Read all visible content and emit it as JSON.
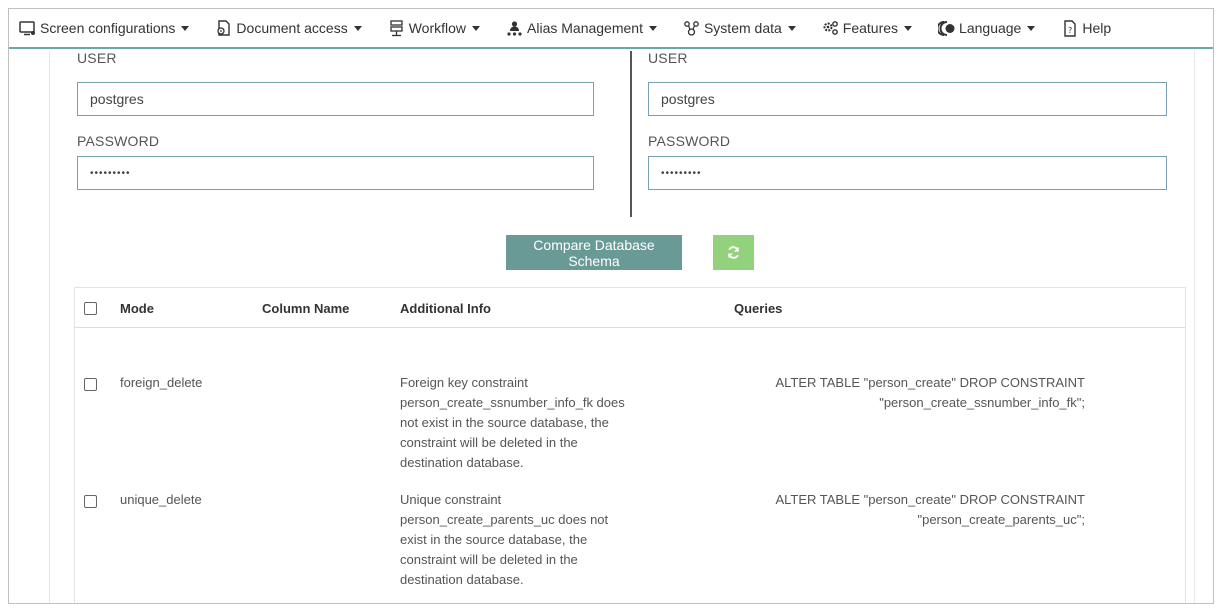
{
  "menu": [
    {
      "label": "Screen configurations",
      "icon": "monitor-icon",
      "has_caret": true
    },
    {
      "label": "Document access",
      "icon": "document-access-icon",
      "has_caret": true
    },
    {
      "label": "Workflow",
      "icon": "workflow-icon",
      "has_caret": true
    },
    {
      "label": "Alias Management",
      "icon": "alias-people-icon",
      "has_caret": true
    },
    {
      "label": "System data",
      "icon": "system-data-icon",
      "has_caret": true
    },
    {
      "label": "Features",
      "icon": "gears-icon",
      "has_caret": true
    },
    {
      "label": "Language",
      "icon": "language-icon",
      "has_caret": true
    },
    {
      "label": "Help",
      "icon": "help-document-icon",
      "has_caret": false
    }
  ],
  "source": {
    "user_label": "USER",
    "user_value": "postgres",
    "password_label": "PASSWORD",
    "password_value": "•••••••••"
  },
  "destination": {
    "user_label": "USER",
    "user_value": "postgres",
    "password_label": "PASSWORD",
    "password_value": "•••••••••"
  },
  "actions": {
    "compare_label": "Compare Database Schema",
    "refresh_icon": "refresh-icon"
  },
  "table": {
    "headers": [
      "Mode",
      "Column Name",
      "Additional Info",
      "Queries"
    ],
    "rows": [
      {
        "mode": "foreign_delete",
        "column_name": "",
        "info_lines": [
          "Foreign key constraint",
          "person_create_ssnumber_info_fk does",
          "not exist in the source database, the",
          "constraint will be deleted in the",
          "destination database."
        ],
        "query_lines": [
          "ALTER TABLE \"person_create\" DROP CONSTRAINT",
          "\"person_create_ssnumber_info_fk\";"
        ]
      },
      {
        "mode": "unique_delete",
        "column_name": "",
        "info_lines": [
          "Unique constraint",
          "person_create_parents_uc does not",
          "exist in the source database, the",
          "constraint will be deleted in the",
          "destination database."
        ],
        "query_lines": [
          "ALTER TABLE \"person_create\" DROP CONSTRAINT",
          "\"person_create_parents_uc\";"
        ]
      }
    ]
  },
  "colors": {
    "accent_border": "#6aa7a7",
    "compare_button": "#6a9a96",
    "refresh_button": "#93d27d",
    "input_border": "#7a9fb5"
  }
}
